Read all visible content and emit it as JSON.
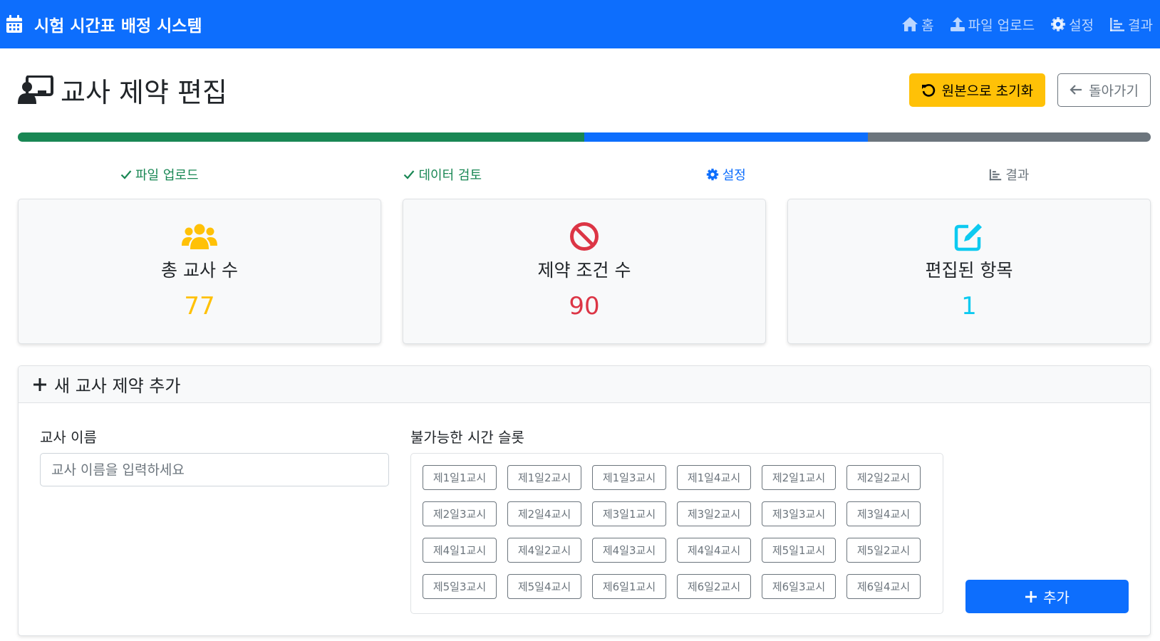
{
  "navbar": {
    "brand": "시험 시간표 배정 시스템",
    "brand_icon": "calendar-icon",
    "links": [
      {
        "label": "홈",
        "icon": "home-icon"
      },
      {
        "label": "파일 업로드",
        "icon": "upload-icon"
      },
      {
        "label": "설정",
        "icon": "gear-icon"
      },
      {
        "label": "결과",
        "icon": "chart-icon"
      }
    ]
  },
  "header": {
    "title": "교사 제약 편집",
    "title_icon": "teacher-icon",
    "reset_label": "원본으로 초기화",
    "back_label": "돌아가기"
  },
  "progress": {
    "segments": [
      {
        "percent": 50,
        "color": "#198754"
      },
      {
        "percent": 25,
        "color": "#0d6efd"
      },
      {
        "percent": 25,
        "color": "#6c757d"
      }
    ]
  },
  "steps": [
    {
      "label": "파일 업로드",
      "icon": "check-icon",
      "color": "#198754"
    },
    {
      "label": "데이터 검토",
      "icon": "check-icon",
      "color": "#198754"
    },
    {
      "label": "설정",
      "icon": "gear-icon",
      "color": "#0d6efd"
    },
    {
      "label": "결과",
      "icon": "chart-icon",
      "color": "#6c757d"
    }
  ],
  "stats": [
    {
      "label": "총 교사 수",
      "value": "77",
      "icon": "users-icon",
      "color": "#ffc107"
    },
    {
      "label": "제약 조건 수",
      "value": "90",
      "icon": "ban-icon",
      "color": "#dc3545"
    },
    {
      "label": "편집된 항목",
      "value": "1",
      "icon": "edit-icon",
      "color": "#0dcaf0"
    }
  ],
  "add_form": {
    "title": "새 교사 제약 추가",
    "name_label": "교사 이름",
    "name_placeholder": "교사 이름을 입력하세요",
    "slots_label": "불가능한 시간 슬롯",
    "slots": [
      "제1일1교시",
      "제1일2교시",
      "제1일3교시",
      "제1일4교시",
      "제2일1교시",
      "제2일2교시",
      "제2일3교시",
      "제2일4교시",
      "제3일1교시",
      "제3일2교시",
      "제3일3교시",
      "제3일4교시",
      "제4일1교시",
      "제4일2교시",
      "제4일3교시",
      "제4일4교시",
      "제5일1교시",
      "제5일2교시",
      "제5일3교시",
      "제5일4교시",
      "제6일1교시",
      "제6일2교시",
      "제6일3교시",
      "제6일4교시"
    ],
    "add_label": "추가"
  }
}
